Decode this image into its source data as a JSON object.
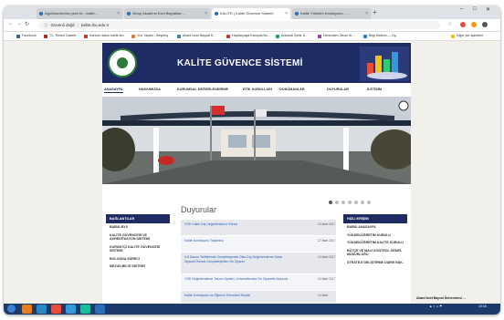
{
  "browser": {
    "tabs": [
      {
        "label": "Ağırlıklandırılan yeni bir - kalite..."
      },
      {
        "label": "Sinop Akademi Ezel Bayraktar ..."
      },
      {
        "label": "KALİTE | Kalite Güvence Sistemi"
      },
      {
        "label": "Kalite Yönetim Komisyonu - ..."
      }
    ],
    "address": {
      "security_label": "Güvenli değil",
      "url": "kalite.ibu.edu.tr"
    },
    "bookmarks": [
      {
        "label": "Facebook",
        "color": "#3b5998"
      },
      {
        "label": "TC. Resmi Gazete",
        "color": "#b22222"
      },
      {
        "label": "Karkom-kamu kalite km",
        "color": "#c0392b"
      },
      {
        "label": "Yüz Yaşam - Beylerış",
        "color": "#e67e22"
      },
      {
        "label": "Abant İzzet Baysal Ü...",
        "color": "#2e86c1"
      },
      {
        "label": "Haydarpaşa Kampüs Bo...",
        "color": "#c0392b"
      },
      {
        "label": "Ankaralı Şehir Ü...",
        "color": "#16a085"
      },
      {
        "label": "Heneralen Otuzu ltl...",
        "color": "#8e44ad"
      },
      {
        "label": "Bilgi Sistemi — Uy...",
        "color": "#2980b9"
      },
      {
        "label": "Diğer yer işaretleri",
        "color": "#f1c40f"
      }
    ]
  },
  "site": {
    "title": "KALİTE GÜVENCE SİSTEMİ",
    "nav": [
      {
        "label": "ANASAYFA"
      },
      {
        "label": "HAKKIMIZDA"
      },
      {
        "label": "KURUMSAL DEĞERLENDİRME"
      },
      {
        "label": "ETİK KURULLARI"
      },
      {
        "label": "DOKÜMANLAR"
      },
      {
        "label": "DUYURULAR"
      },
      {
        "label": "İLETİŞİM"
      }
    ],
    "left_box": {
      "title": "BAĞLANTILAR",
      "items": [
        {
          "label": "BAİBÜ-BYS"
        },
        {
          "label": "KALİTE GÜVENCESİ VE AKREDİTASYON SİSTEMİ"
        },
        {
          "label": "KURUM İÇİ KALİTE GÜVENCESİ SİSTEMİ"
        },
        {
          "label": "BOLOGNA SÜRECİ"
        },
        {
          "label": "MEZUN BİLGİ SİSTEMİ"
        }
      ]
    },
    "right_box": {
      "title": "HIZLI ERİŞİM",
      "items": [
        {
          "label": "BAİBÜ ANASAYFA"
        },
        {
          "label": "YÜKSEKÖĞRETİM KURULU"
        },
        {
          "label": "YÜKSEKÖĞRETİM KALİTE KURULU"
        },
        {
          "label": "BÜTÇE VE MALİ KONTROL GENEL MÜDÜRLÜĞÜ"
        },
        {
          "label": "STRATEJİ GELİŞTİRME DAİRE BŞK."
        }
      ]
    },
    "announcements": {
      "title": "Duyurular",
      "items": [
        {
          "title": "YÖK Kalite Dış Değerlendirme Süreci",
          "date": "14 Mart 2017"
        },
        {
          "title": "Kalite Komisyonu Toplantısı",
          "date": "17 Mart 2017"
        },
        {
          "title": "9-8 Kasım Tarihlerinde Gerçekleşecek Olan Dış Değerlendirme Saha Ziyareti Öncesi Gerçekleştirilen Ön Ziyaret",
          "date": "14 Mart 2017"
        },
        {
          "title": "YÖK Değerlendirme Takımı Üyeleri, Üniversitemize Ön Ziyarette Bulundu",
          "date": "14 Mart 2017"
        },
        {
          "title": "Kalite Komisyonu'na Öğrenci Temsilcisi Seçildi",
          "date": "14 Mart"
        }
      ]
    },
    "slider": {
      "active_index": 0,
      "count": 7
    }
  },
  "taskbar": {
    "tray_note": "Abant İzzet Baysal Üniversitesi ...",
    "clock": "10:16"
  }
}
